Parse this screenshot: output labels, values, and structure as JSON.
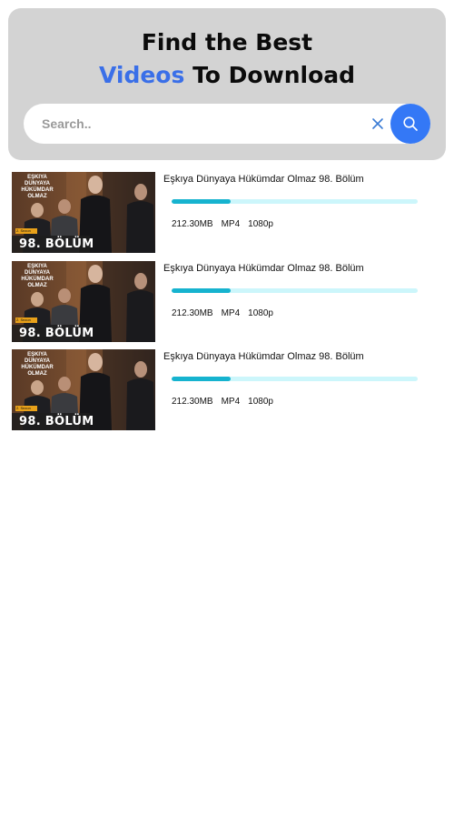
{
  "hero": {
    "title_line1": "Find the Best",
    "title_accent": "Videos",
    "title_rest": " To Download",
    "accent_color": "#3a6fe8"
  },
  "search": {
    "placeholder": "Search..",
    "value": "",
    "clear_icon": "close-icon",
    "search_icon": "search-icon",
    "button_color": "#3478f6"
  },
  "videos": [
    {
      "title": "Eşkıya Dünyaya Hükümdar Olmaz 98. Bölüm",
      "thumbnail_caption": "98. BÖLÜM",
      "thumbnail_logo": "EŞKIYA DÜNYAYA HÜKÜMDAR OLMAZ",
      "thumbnail_badge": "2. Sezon",
      "size": "212.30MB",
      "format": "MP4",
      "resolution": "1080p",
      "progress": 0.24
    },
    {
      "title": "Eşkıya Dünyaya Hükümdar Olmaz 98. Bölüm",
      "thumbnail_caption": "98. BÖLÜM",
      "thumbnail_logo": "EŞKIYA DÜNYAYA HÜKÜMDAR OLMAZ",
      "thumbnail_badge": "2. Sezon",
      "size": "212.30MB",
      "format": "MP4",
      "resolution": "1080p",
      "progress": 0.24
    },
    {
      "title": "Eşkıya Dünyaya Hükümdar Olmaz 98. Bölüm",
      "thumbnail_caption": "98. BÖLÜM",
      "thumbnail_logo": "EŞKIYA DÜNYAYA HÜKÜMDAR OLMAZ",
      "thumbnail_badge": "2. Sezon",
      "size": "212.30MB",
      "format": "MP4",
      "resolution": "1080p",
      "progress": 0.24
    }
  ]
}
